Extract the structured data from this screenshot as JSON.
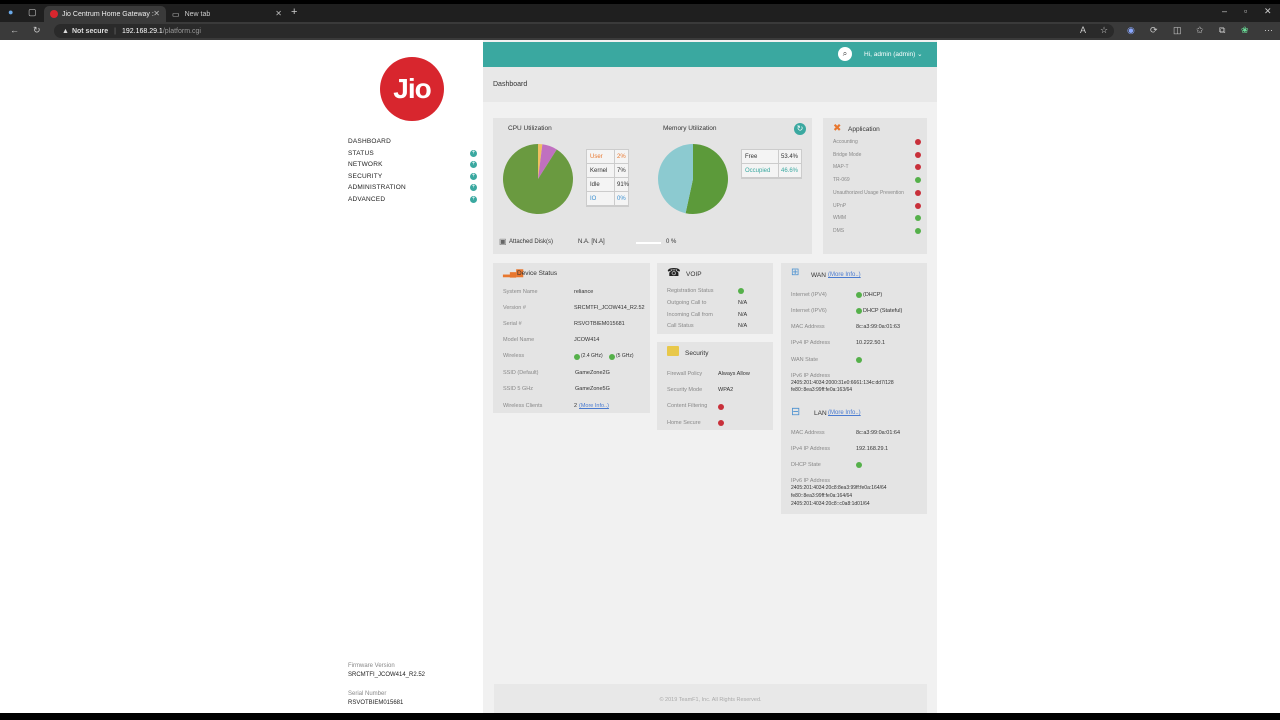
{
  "browser": {
    "tabs": [
      {
        "label": "Jio Centrum Home Gateway :"
      },
      {
        "label": "New tab"
      }
    ],
    "security_label": "Not secure",
    "url_host": "192.168.29.1",
    "url_path": "/platform.cgi"
  },
  "sidebar": {
    "logo_text": "Jio",
    "nav": [
      {
        "label": "DASHBOARD"
      },
      {
        "label": "STATUS"
      },
      {
        "label": "NETWORK"
      },
      {
        "label": "SECURITY"
      },
      {
        "label": "ADMINISTRATION"
      },
      {
        "label": "ADVANCED"
      }
    ],
    "firmware_label": "Firmware Version",
    "firmware_value": "SRCMTFI_JCOW414_R2.52",
    "serial_label": "Serial Number",
    "serial_value": "RSVOTBIEM015681"
  },
  "header": {
    "user": "Hi, admin (admin)",
    "breadcrumb": "Dashboard"
  },
  "utilization": {
    "cpu_title": "CPU Utilization",
    "memory_title": "Memory Utilization",
    "cpu_legend": [
      {
        "name": "User",
        "value": "2%",
        "color": "#e8772e"
      },
      {
        "name": "Kernel",
        "value": "7%",
        "color": "#333333"
      },
      {
        "name": "Idle",
        "value": "91%",
        "color": "#333333"
      },
      {
        "name": "IO",
        "value": "0%",
        "color": "#3a8fd0"
      }
    ],
    "cpu_slices": [
      2,
      7,
      91,
      0
    ],
    "memory_legend": [
      {
        "name": "Free",
        "value": "53.4%",
        "color": "#333333"
      },
      {
        "name": "Occupied",
        "value": "46.6%",
        "color": "#3aa8a0"
      }
    ],
    "memory_slices": [
      53.4,
      46.6
    ],
    "disk_label": "Attached Disk(s)",
    "disk_value": "N.A. [N.A]",
    "disk_percent": "0 %"
  },
  "application": {
    "title": "Application",
    "items": [
      {
        "label": "Accounting",
        "status": "off"
      },
      {
        "label": "Bridge Mode",
        "status": "off"
      },
      {
        "label": "MAP-T",
        "status": "off"
      },
      {
        "label": "TR-069",
        "status": "on"
      },
      {
        "label": "Unauthorized Usage Prevention",
        "status": "off"
      },
      {
        "label": "UPnP",
        "status": "off"
      },
      {
        "label": "WMM",
        "status": "on"
      },
      {
        "label": "DMS",
        "status": "on"
      }
    ]
  },
  "device": {
    "title": "Device Status",
    "system_name_label": "System Name",
    "system_name": "reliance",
    "version_label": "Version #",
    "version": "SRCMTFI_JCOW414_R2.52",
    "serial_label": "Serial #",
    "serial": "RSVOTBIEM015681",
    "model_label": "Model Name",
    "model": "JCOW414",
    "wireless_label": "Wireless",
    "wireless_24": "(2.4 GHz)",
    "wireless_5": "(5 GHz)",
    "ssid_default_label": "SSID (Default)",
    "ssid_default": "GameZone2G",
    "ssid_5_label": "SSID 5 GHz",
    "ssid_5": "GameZone5G",
    "clients_label": "Wireless Clients",
    "clients": "2",
    "clients_link": "(More Info..)"
  },
  "voip": {
    "title": "VOIP",
    "reg_label": "Registration Status",
    "out_label": "Outgoing Call to",
    "out": "N/A",
    "in_label": "Incoming Call from",
    "in": "N/A",
    "call_label": "Call Status",
    "call": "N/A"
  },
  "security": {
    "title": "Security",
    "firewall_label": "Firewall Policy",
    "firewall": "Always Allow",
    "mode_label": "Security Mode",
    "mode": "WPA2",
    "content_label": "Content Filtering",
    "home_label": "Home Secure"
  },
  "wan": {
    "title": "WAN",
    "link": "(More Info..)",
    "ipv4_label": "Internet (IPV4)",
    "ipv4": "(DHCP)",
    "ipv6_label": "Internet (IPV6)",
    "ipv6": "DHCP (Stateful)",
    "mac_label": "MAC Address",
    "mac": "8c:a3:99:0a:01:63",
    "ip_label": "IPv4 IP Address",
    "ip": "10.222.50.1",
    "state_label": "WAN State",
    "ip6_label": "IPv6 IP Address",
    "ip6_1": "2405:201:4034:2000:31e0:6661:134c:dd7/128",
    "ip6_2": "fe80::8ea3:99ff:fe0a:163/64"
  },
  "lan": {
    "title": "LAN",
    "link": "(More Info..)",
    "mac_label": "MAC Address",
    "mac": "8c:a3:99:0a:01:64",
    "ip_label": "IPv4 IP Address",
    "ip": "192.168.29.1",
    "dhcp_label": "DHCP State",
    "ip6_label": "IPv6 IP Address",
    "ip6_1": "2405:201:4034:20c8:8ea3:99ff:fe0a:164/64",
    "ip6_2": "fe80::8ea3:99ff:fe0a:164/64",
    "ip6_3": "2405:201:4034:20c8::c0a8:1d01/64"
  },
  "footer": {
    "copyright": "© 2019 TeamF1, Inc. All Rights Reserved."
  }
}
